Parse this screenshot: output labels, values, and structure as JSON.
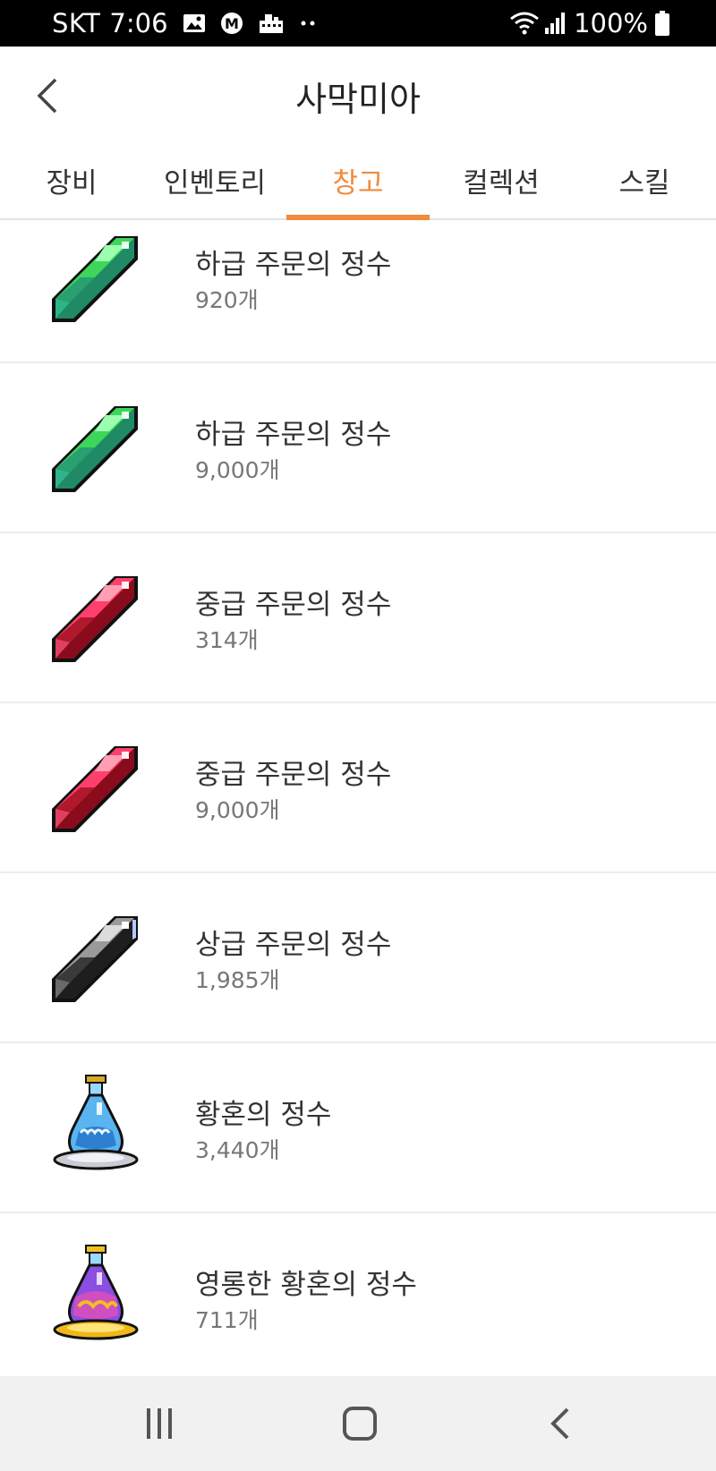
{
  "status_bar": {
    "carrier": "SKT",
    "time": "7:06",
    "battery": "100%",
    "left_icons": [
      "gallery-icon",
      "m-app-icon",
      "building-icon",
      "more-dots-icon"
    ],
    "right_icons": [
      "wifi-icon",
      "signal-icon",
      "battery-icon"
    ]
  },
  "header": {
    "title": "사막미아"
  },
  "tabs": [
    {
      "label": "장비",
      "active": false
    },
    {
      "label": "인벤토리",
      "active": false
    },
    {
      "label": "창고",
      "active": true
    },
    {
      "label": "컬렉션",
      "active": false
    },
    {
      "label": "스킬",
      "active": false
    }
  ],
  "items": [
    {
      "name": "하급 주문의 정수",
      "count": "920개",
      "icon": "green-crystal-icon"
    },
    {
      "name": "하급 주문의 정수",
      "count": "9,000개",
      "icon": "green-crystal-icon"
    },
    {
      "name": "중급 주문의 정수",
      "count": "314개",
      "icon": "red-crystal-icon"
    },
    {
      "name": "중급 주문의 정수",
      "count": "9,000개",
      "icon": "red-crystal-icon"
    },
    {
      "name": "상급 주문의 정수",
      "count": "1,985개",
      "icon": "black-crystal-icon"
    },
    {
      "name": "황혼의 정수",
      "count": "3,440개",
      "icon": "blue-bottle-icon"
    },
    {
      "name": "영롱한 황혼의 정수",
      "count": "711개",
      "icon": "purple-bottle-icon"
    }
  ],
  "colors": {
    "accent": "#f08a3c",
    "status_bar": "#000000",
    "nav_bar": "#f1f1f1"
  },
  "nav_bar": {
    "buttons": [
      "recent-apps-icon",
      "home-icon",
      "back-icon"
    ]
  }
}
